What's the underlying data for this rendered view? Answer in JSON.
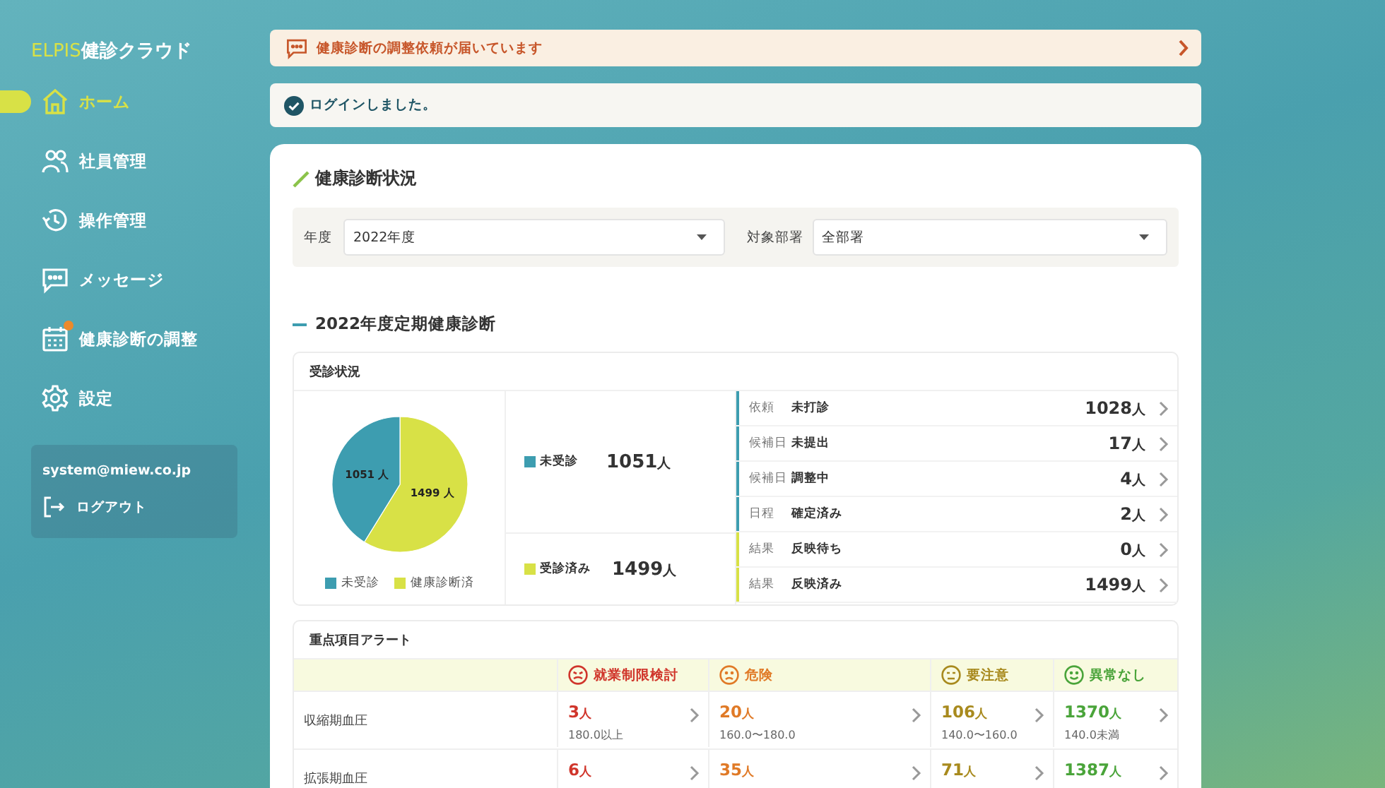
{
  "sidebar": {
    "logo_brand": "ELPIS",
    "logo_text": "健診クラウド",
    "items": [
      {
        "label": "ホーム",
        "selected": true,
        "badge": false
      },
      {
        "label": "社員管理",
        "selected": false,
        "badge": false
      },
      {
        "label": "操作管理",
        "selected": false,
        "badge": false
      },
      {
        "label": "メッセージ",
        "selected": false,
        "badge": false
      },
      {
        "label": "健康診断の調整",
        "selected": false,
        "badge": true
      },
      {
        "label": "設定",
        "selected": false,
        "badge": false
      }
    ],
    "account": {
      "email": "system@miew.co.jp",
      "logout": "ログアウト"
    }
  },
  "notice": {
    "text": "健康診断の調整依頼が届いています"
  },
  "toast": {
    "text": "ログインしました。"
  },
  "panel": {
    "title": "健康診断状況",
    "filters": [
      {
        "label": "年度",
        "value": "2022年度"
      },
      {
        "label": "対象部署",
        "value": "全部署"
      }
    ],
    "section_title": "2022年度定期健康診断",
    "status": {
      "title": "受診状況",
      "chart_data": {
        "type": "pie",
        "categories": [
          "未受診",
          "健康診断済"
        ],
        "series": [
          {
            "values": [
              41.2,
              58.8
            ]
          }
        ],
        "colors": [
          "#3d9db0",
          "#d8e146"
        ],
        "value_labels": [
          "1051 人",
          "1499 人"
        ]
      },
      "totals": [
        {
          "label": "未受診",
          "value": "1051",
          "unit": "人",
          "color": "#3d9db0"
        },
        {
          "label": "受診済み",
          "value": "1499",
          "unit": "人",
          "color": "#d8e146"
        }
      ],
      "rows": [
        {
          "stage": "依頼",
          "label": "未打診",
          "value": "1028",
          "unit": "人",
          "color": "#3d9db0"
        },
        {
          "stage": "候補日",
          "label": "未提出",
          "value": "17",
          "unit": "人",
          "color": "#3d9db0"
        },
        {
          "stage": "候補日",
          "label": "調整中",
          "value": "4",
          "unit": "人",
          "color": "#3d9db0"
        },
        {
          "stage": "日程",
          "label": "確定済み",
          "value": "2",
          "unit": "人",
          "color": "#3d9db0"
        },
        {
          "stage": "結果",
          "label": "反映待ち",
          "value": "0",
          "unit": "人",
          "color": "#d8e146"
        },
        {
          "stage": "結果",
          "label": "反映済み",
          "value": "1499",
          "unit": "人",
          "color": "#d8e146"
        }
      ]
    },
    "alerts": {
      "title": "重点項目アラート",
      "columns": [
        {
          "label": "就業制限検討",
          "kind": "restrict"
        },
        {
          "label": "危険",
          "kind": "danger"
        },
        {
          "label": "要注意",
          "kind": "caution"
        },
        {
          "label": "異常なし",
          "kind": "normal"
        }
      ],
      "rows": [
        {
          "label": "収縮期血圧",
          "cells": [
            {
              "value": "3",
              "unit": "人",
              "range": "180.0以上"
            },
            {
              "value": "20",
              "unit": "人",
              "range": "160.0〜180.0"
            },
            {
              "value": "106",
              "unit": "人",
              "range": "140.0〜160.0"
            },
            {
              "value": "1370",
              "unit": "人",
              "range": "140.0未満"
            }
          ]
        },
        {
          "label": "拡張期血圧",
          "cells": [
            {
              "value": "6",
              "unit": "人"
            },
            {
              "value": "35",
              "unit": "人"
            },
            {
              "value": "71",
              "unit": "人"
            },
            {
              "value": "1387",
              "unit": "人"
            }
          ]
        }
      ]
    }
  }
}
